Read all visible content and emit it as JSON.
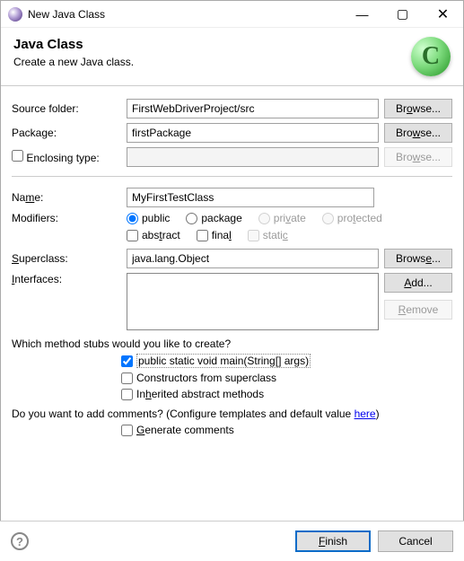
{
  "window": {
    "title": "New Java Class"
  },
  "header": {
    "title": "Java Class",
    "subtitle": "Create a new Java class.",
    "icon_letter": "C"
  },
  "fields": {
    "source_folder": {
      "label": "Source folder:",
      "value": "FirstWebDriverProject/src"
    },
    "package": {
      "label": "Package:",
      "value": "firstPackage"
    },
    "enclosing": {
      "label": "Enclosing type:",
      "value": ""
    },
    "name": {
      "label": "Name:",
      "value": "MyFirstTestClass"
    },
    "modifiers": {
      "label": "Modifiers:"
    },
    "modifier_opts": {
      "public": "public",
      "package": "package",
      "private": "private",
      "protected": "protected",
      "abstract": "abstract",
      "final": "final",
      "static": "static"
    },
    "superclass": {
      "label": "Superclass:",
      "value": "java.lang.Object"
    },
    "interfaces": {
      "label": "Interfaces:"
    }
  },
  "buttons": {
    "browse": "Browse...",
    "add": "Add...",
    "remove": "Remove",
    "finish": "Finish",
    "cancel": "Cancel"
  },
  "stubs": {
    "question": "Which method stubs would you like to create?",
    "main": "public static void main(String[] args)",
    "constructors": "Constructors from superclass",
    "inherited": "Inherited abstract methods"
  },
  "comments": {
    "question_pre": "Do you want to add comments? (Configure templates and default value ",
    "link": "here",
    "question_post": ")",
    "generate": "Generate comments"
  }
}
